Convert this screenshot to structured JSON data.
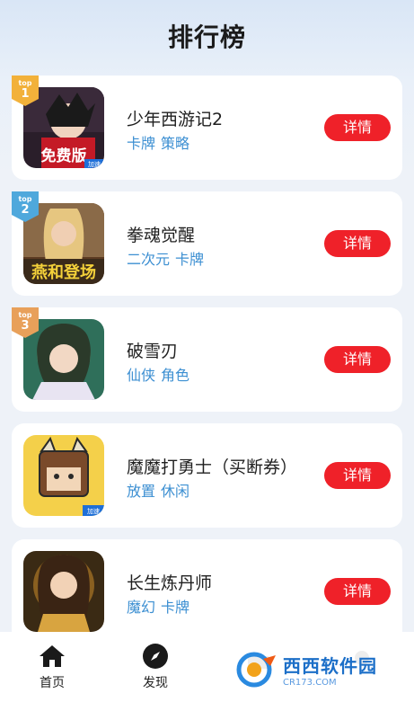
{
  "header": {
    "title": "排行榜"
  },
  "rank_top_label": "top",
  "detail_label": "详情",
  "games": [
    {
      "rank": "1",
      "name": "少年西游记2",
      "tags": [
        "卡牌",
        "策略"
      ]
    },
    {
      "rank": "2",
      "name": "拳魂觉醒",
      "tags": [
        "二次元",
        "卡牌"
      ]
    },
    {
      "rank": "3",
      "name": "破雪刃",
      "tags": [
        "仙侠",
        "角色"
      ]
    },
    {
      "rank": "",
      "name": "魔魔打勇士（买断券）",
      "tags": [
        "放置",
        "休闲"
      ]
    },
    {
      "rank": "",
      "name": "长生炼丹师",
      "tags": [
        "魔幻",
        "卡牌"
      ]
    }
  ],
  "tabbar": {
    "tabs": [
      {
        "label": "首页",
        "icon": "home-icon"
      },
      {
        "label": "发现",
        "icon": "compass-icon"
      },
      {
        "label": "",
        "icon": "grid-icon"
      },
      {
        "label": "",
        "icon": "user-icon"
      }
    ]
  },
  "watermark": {
    "text": "西西软件园",
    "sub": "CR173.COM"
  },
  "colors": {
    "accent": "#ef2129",
    "tag": "#3c8fd2",
    "badge": "#f2b13a"
  }
}
